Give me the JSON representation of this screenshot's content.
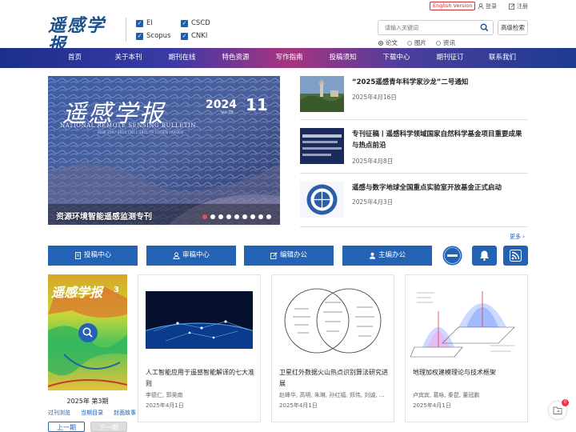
{
  "header": {
    "logo_cn": "遥感学报",
    "logo_en": "NATIONAL REMOTE SENSING BULLETIN",
    "indexes": [
      "EI",
      "Scopus",
      "CSCD",
      "CNKI"
    ],
    "english_version": "English Version",
    "login": "登录",
    "register": "注册",
    "search_placeholder": "请输入关键词",
    "advanced_search": "高级检索",
    "radio_options": [
      "论文",
      "图片",
      "资讯"
    ],
    "radio_selected": "论文"
  },
  "nav": {
    "items": [
      "首页",
      "关于本刊",
      "期刊在线",
      "特色资源",
      "写作指南",
      "投稿须知",
      "下载中心",
      "期刊征订",
      "联系我们"
    ]
  },
  "banner": {
    "title_cn": "遥感学报",
    "year": "2024",
    "issue": "11",
    "vol": "Vol.28",
    "title_en": "NATIONAL REMOTE SENSING BULLETIN",
    "issn": "ISSN 2097-4620  CN11-3841/TP  CODEN YAXUE9",
    "caption": "资源环境智能遥感监测专刊",
    "active_dot": 0,
    "dot_count": 9
  },
  "news": [
    {
      "title": "“2025遥感青年科学家沙龙”二号通知",
      "date": "2025年4月16日"
    },
    {
      "title": "专刊征稿丨遥感科学领域国家自然科学基金项目重要成果与热点前沿",
      "date": "2025年4月8日"
    },
    {
      "title": "遥感与数字地球全国重点实验室开放基金正式启动",
      "date": "2025年4月3日"
    }
  ],
  "more": "更多",
  "buttons": [
    "投稿中心",
    "审稿中心",
    "编辑办公",
    "主编办公"
  ],
  "issue": {
    "title": "2025年 第3期",
    "links": [
      "过刊浏览",
      "当期目录",
      "封面故事"
    ],
    "prev": "上一期",
    "next": "下一期",
    "cover_text": "遥感学报",
    "cover_no": "3"
  },
  "cards": [
    {
      "title": "人工智能应用于遥感智能解译的七大准则",
      "authors": "李德仁, 郭昊南",
      "date": "2025年4月1日"
    },
    {
      "title": "卫星红外数据火山热点识别算法研究进展",
      "authors": "赵峰华, 高明, 朱琳, 孙红福, 郑伟, 刘诚, 李…",
      "date": "2025年4月1日"
    },
    {
      "title": "地理加权建模理论与技术框架",
      "authors": "卢宾宾, 葛咏, 秦昆, 董冠鹏",
      "date": "2025年4月1日"
    }
  ],
  "float_badge": "0",
  "colors": {
    "brand": "#1f5ea8",
    "button": "#2462b4",
    "accent_red": "#e85050"
  }
}
